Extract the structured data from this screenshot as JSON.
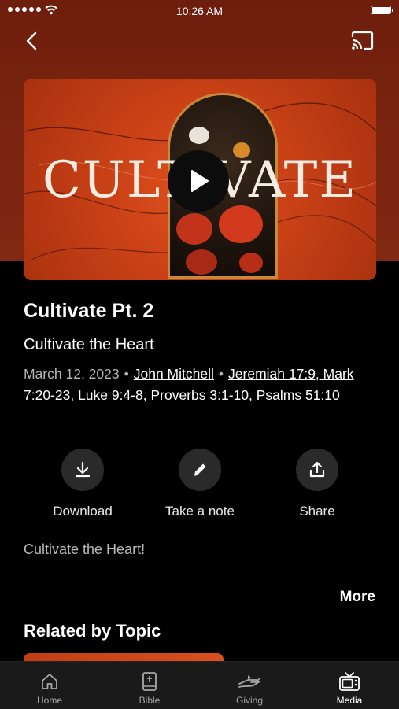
{
  "status_bar": {
    "time": "10:26 AM"
  },
  "artwork": {
    "title_text": "CULTIVATE"
  },
  "sermon": {
    "title": "Cultivate Pt. 2",
    "subtitle": "Cultivate the Heart",
    "date": "March 12, 2023",
    "speaker": "John Mitchell",
    "scripture": "Jeremiah 17:9, Mark 7:20-23, Luke 9:4-8, Proverbs 3:1-10, Psalms 51:10",
    "description": "Cultivate the Heart!"
  },
  "actions": [
    {
      "label": "Download",
      "icon": "download-icon"
    },
    {
      "label": "Take a note",
      "icon": "pencil-icon"
    },
    {
      "label": "Share",
      "icon": "share-icon"
    }
  ],
  "more_label": "More",
  "related_heading": "Related by Topic",
  "tabs": [
    {
      "label": "Home",
      "icon": "home-icon",
      "active": false
    },
    {
      "label": "Bible",
      "icon": "bible-icon",
      "active": false
    },
    {
      "label": "Giving",
      "icon": "giving-icon",
      "active": false
    },
    {
      "label": "Media",
      "icon": "media-tv-icon",
      "active": true
    }
  ],
  "colors": {
    "header_bg": "#7a2410",
    "art_orange": "#cc4217",
    "tab_bg": "#1a1a1a"
  }
}
